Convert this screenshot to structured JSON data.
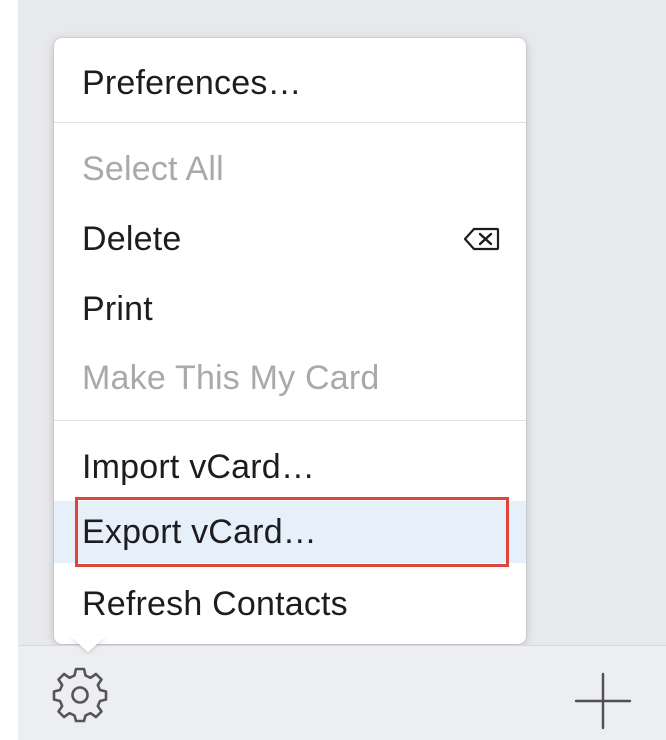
{
  "menu": {
    "items": [
      {
        "label": "Preferences…",
        "enabled": true
      },
      {
        "label": "Select All",
        "enabled": false
      },
      {
        "label": "Delete",
        "enabled": true,
        "shortcut_icon": "delete-key-icon"
      },
      {
        "label": "Print",
        "enabled": true
      },
      {
        "label": "Make This My Card",
        "enabled": false
      },
      {
        "label": "Import vCard…",
        "enabled": true
      },
      {
        "label": "Export vCard…",
        "enabled": true,
        "highlighted": true
      },
      {
        "label": "Refresh Contacts",
        "enabled": true
      }
    ]
  },
  "toolbar": {
    "left_icon": "gear-icon",
    "right_icon": "plus-icon"
  },
  "colors": {
    "highlight_bg": "#e6f0fa",
    "annotation_border": "#e0453a",
    "disabled_text": "#a9a9ad"
  }
}
